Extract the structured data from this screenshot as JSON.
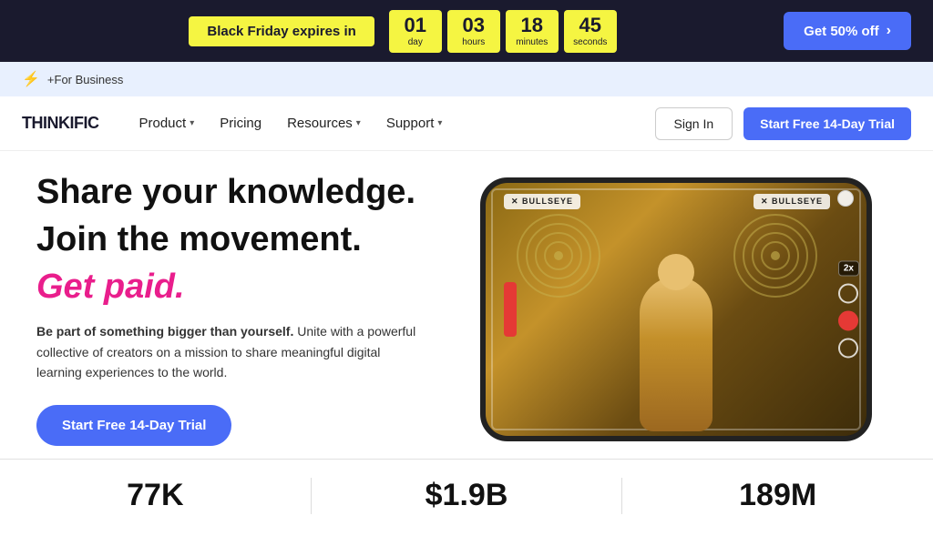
{
  "topBanner": {
    "text": "Black Friday expires in",
    "countdown": {
      "day": {
        "number": "01",
        "label": "day"
      },
      "hours": {
        "number": "03",
        "label": "hours"
      },
      "minutes": {
        "number": "18",
        "label": "minutes"
      },
      "seconds": {
        "number": "45",
        "label": "seconds"
      }
    },
    "ctaLabel": "Get 50% off",
    "ctaArrow": "›"
  },
  "subBanner": {
    "icon": "⚡",
    "text": "+For Business"
  },
  "nav": {
    "logo": "THINKIFIC",
    "links": [
      {
        "label": "Product",
        "hasChevron": true
      },
      {
        "label": "Pricing",
        "hasChevron": false
      },
      {
        "label": "Resources",
        "hasChevron": true
      },
      {
        "label": "Support",
        "hasChevron": true
      }
    ],
    "signInLabel": "Sign In",
    "trialLabel": "Start Free 14-Day Trial"
  },
  "hero": {
    "line1": "Share your knowledge.",
    "line2": "Join the movement.",
    "line3": "Get paid.",
    "subBold": "Be part of something bigger than yourself.",
    "subText": " Unite with a powerful collective of creators on a mission to share meaningful digital learning experiences to the world.",
    "ctaLabel": "Start Free 14-Day Trial",
    "bullseye1": "✕ BULLSEYE",
    "bullseye2": "✕ BULLSEYE"
  },
  "stats": [
    {
      "value": "77K"
    },
    {
      "value": "$1.9B"
    },
    {
      "value": "189M"
    }
  ]
}
